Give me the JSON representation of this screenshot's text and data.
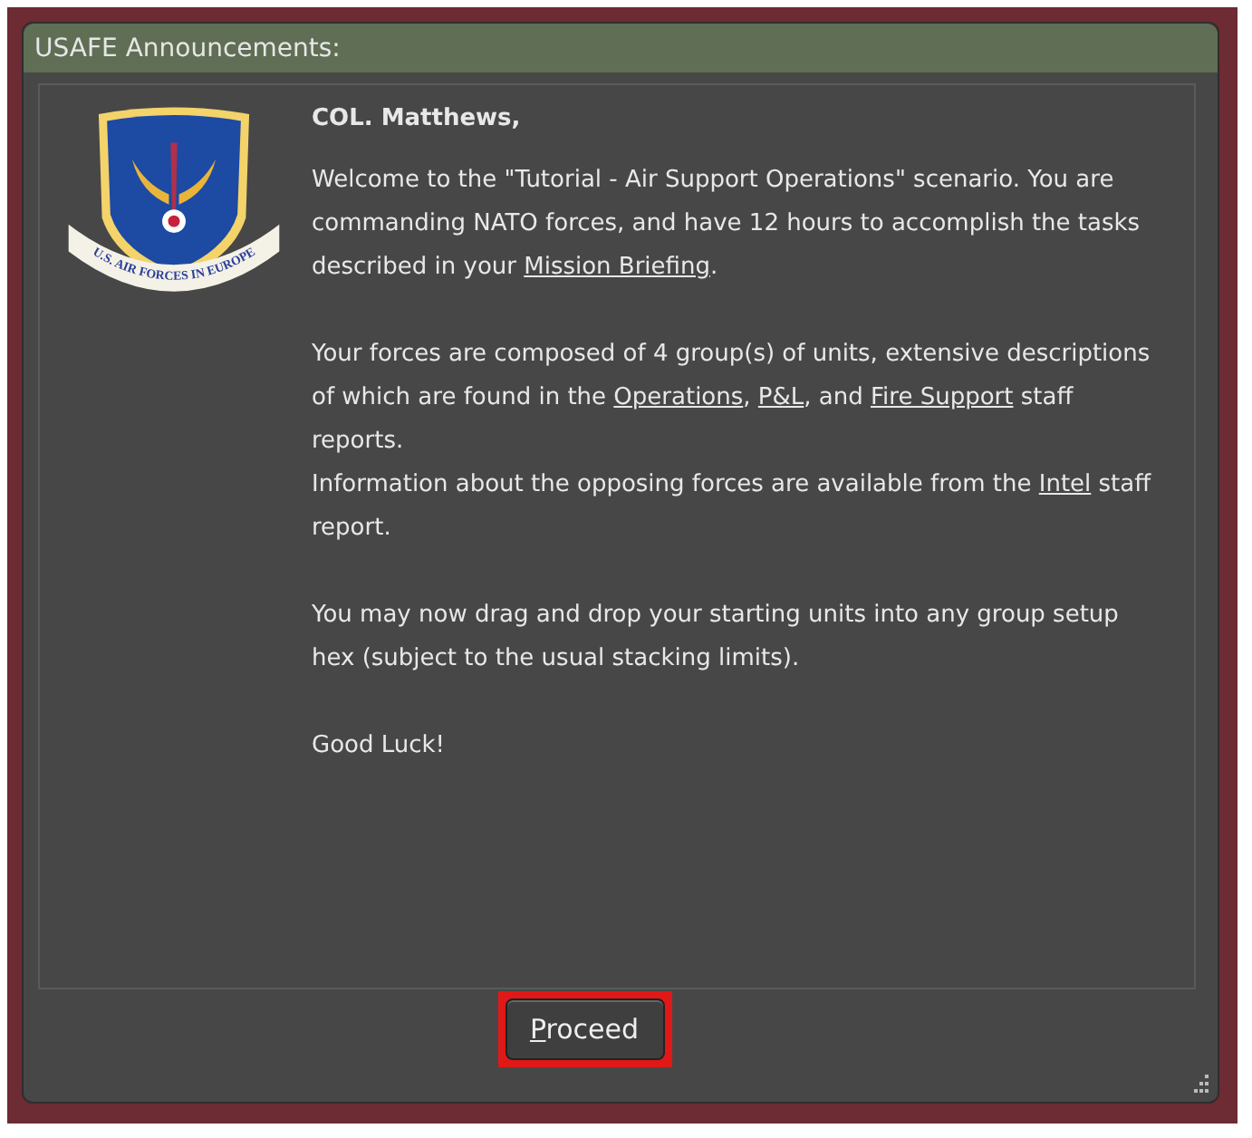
{
  "window": {
    "title": "USAFE Announcements:"
  },
  "emblem": {
    "text": "U.S. AIR FORCES IN EUROPE"
  },
  "message": {
    "salutation": "COL. Matthews,",
    "paragraphs": [
      {
        "lines": [
          {
            "segments": [
              {
                "text": "Welcome to the \"Tutorial - Air Support Operations\" scenario. You are commanding NATO forces, and have 12 hours to accomplish the tasks described in your ",
                "link": false
              },
              {
                "text": "Mission Briefing",
                "link": true
              },
              {
                "text": ".",
                "link": false
              }
            ]
          }
        ]
      },
      {
        "lines": [
          {
            "segments": [
              {
                "text": "Your forces are composed of 4 group(s) of units, extensive descriptions of which are found in the ",
                "link": false
              },
              {
                "text": "Operations",
                "link": true
              },
              {
                "text": ", ",
                "link": false
              },
              {
                "text": "P&L",
                "link": true
              },
              {
                "text": ", and ",
                "link": false
              },
              {
                "text": "Fire Support",
                "link": true
              },
              {
                "text": " staff reports.",
                "link": false
              }
            ]
          },
          {
            "segments": [
              {
                "text": "Information about the opposing forces are available from the ",
                "link": false
              },
              {
                "text": "Intel",
                "link": true
              },
              {
                "text": " staff report.",
                "link": false
              }
            ]
          }
        ]
      },
      {
        "lines": [
          {
            "segments": [
              {
                "text": "You may now drag and drop your starting units into any group setup hex (subject to the usual stacking limits).",
                "link": false
              }
            ]
          }
        ]
      },
      {
        "lines": [
          {
            "segments": [
              {
                "text": "Good Luck!",
                "link": false
              }
            ]
          }
        ]
      }
    ]
  },
  "buttons": [
    {
      "label": "Proceed",
      "highlighted": true
    }
  ]
}
